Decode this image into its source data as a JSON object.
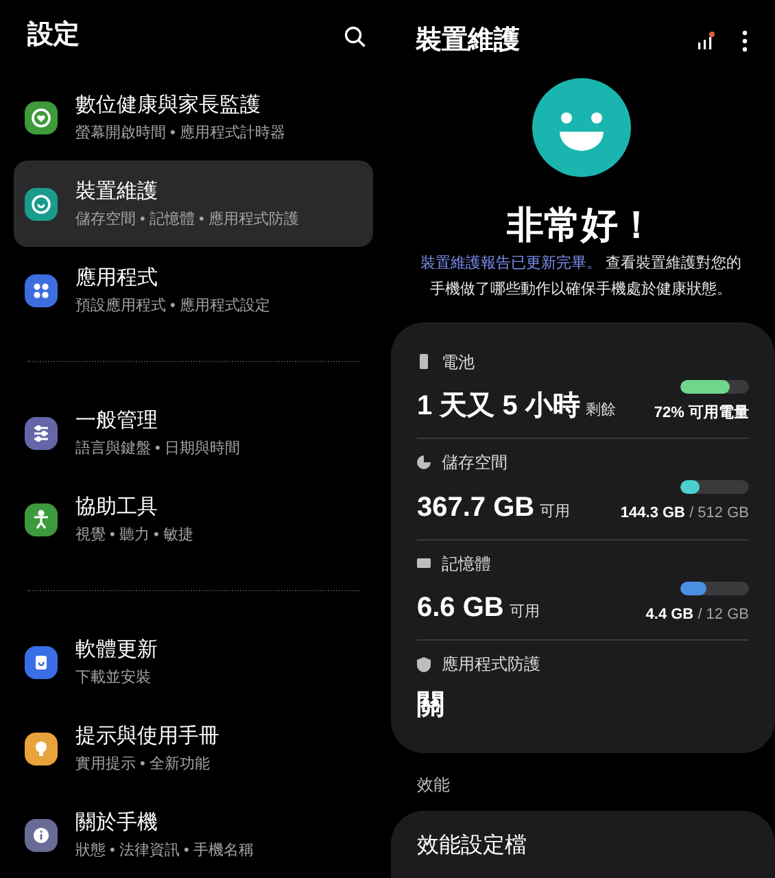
{
  "settings": {
    "title": "設定",
    "groups": [
      {
        "items": [
          {
            "title": "數位健康與家長監護",
            "subtitle": "螢幕開啟時間 • 應用程式計時器",
            "color": "#3e9a3a",
            "selected": false
          },
          {
            "title": "裝置維護",
            "subtitle": "儲存空間 • 記憶體 • 應用程式防護",
            "color": "#1a9c8c",
            "selected": true
          },
          {
            "title": "應用程式",
            "subtitle": "預設應用程式 • 應用程式設定",
            "color": "#3d6ee0",
            "selected": false
          }
        ]
      },
      {
        "items": [
          {
            "title": "一般管理",
            "subtitle": "語言與鍵盤 • 日期與時間",
            "color": "#6466a8",
            "selected": false
          },
          {
            "title": "協助工具",
            "subtitle": "視覺 • 聽力 • 敏捷",
            "color": "#3c9a3c",
            "selected": false
          }
        ]
      },
      {
        "items": [
          {
            "title": "軟體更新",
            "subtitle": "下載並安裝",
            "color": "#3a6ee6",
            "selected": false
          },
          {
            "title": "提示與使用手冊",
            "subtitle": "實用提示 • 全新功能",
            "color": "#e8a33a",
            "selected": false
          },
          {
            "title": "關於手機",
            "subtitle": "狀態 • 法律資訊 • 手機名稱",
            "color": "#6a6a96",
            "selected": false
          }
        ]
      }
    ]
  },
  "device_care": {
    "title": "裝置維護",
    "status": "非常好！",
    "description_link": "裝置維護報告已更新完畢。",
    "description_text": "查看裝置維護對您的手機做了哪些動作以確保手機處於健康狀態。",
    "stats": [
      {
        "kind": "meter",
        "label": "電池",
        "value": "1 天又 5 小時",
        "unit": "剩餘",
        "level": 0.72,
        "color": "#6fd68a",
        "detail_main": "72% 可用電量"
      },
      {
        "kind": "meter",
        "label": "儲存空間",
        "value": "367.7 GB",
        "unit": "可用",
        "level": 0.28,
        "color": "#4ccfcf",
        "detail_main": "144.3 GB",
        "detail_rest": " / 512 GB"
      },
      {
        "kind": "meter",
        "label": "記憶體",
        "value": "6.6 GB",
        "unit": "可用",
        "level": 0.37,
        "color": "#4a90e2",
        "detail_main": "4.4 GB",
        "detail_rest": " / 12 GB"
      },
      {
        "kind": "status",
        "label": "應用程式防護",
        "value": "關"
      }
    ],
    "section": "效能",
    "performance_title": "效能設定檔"
  }
}
